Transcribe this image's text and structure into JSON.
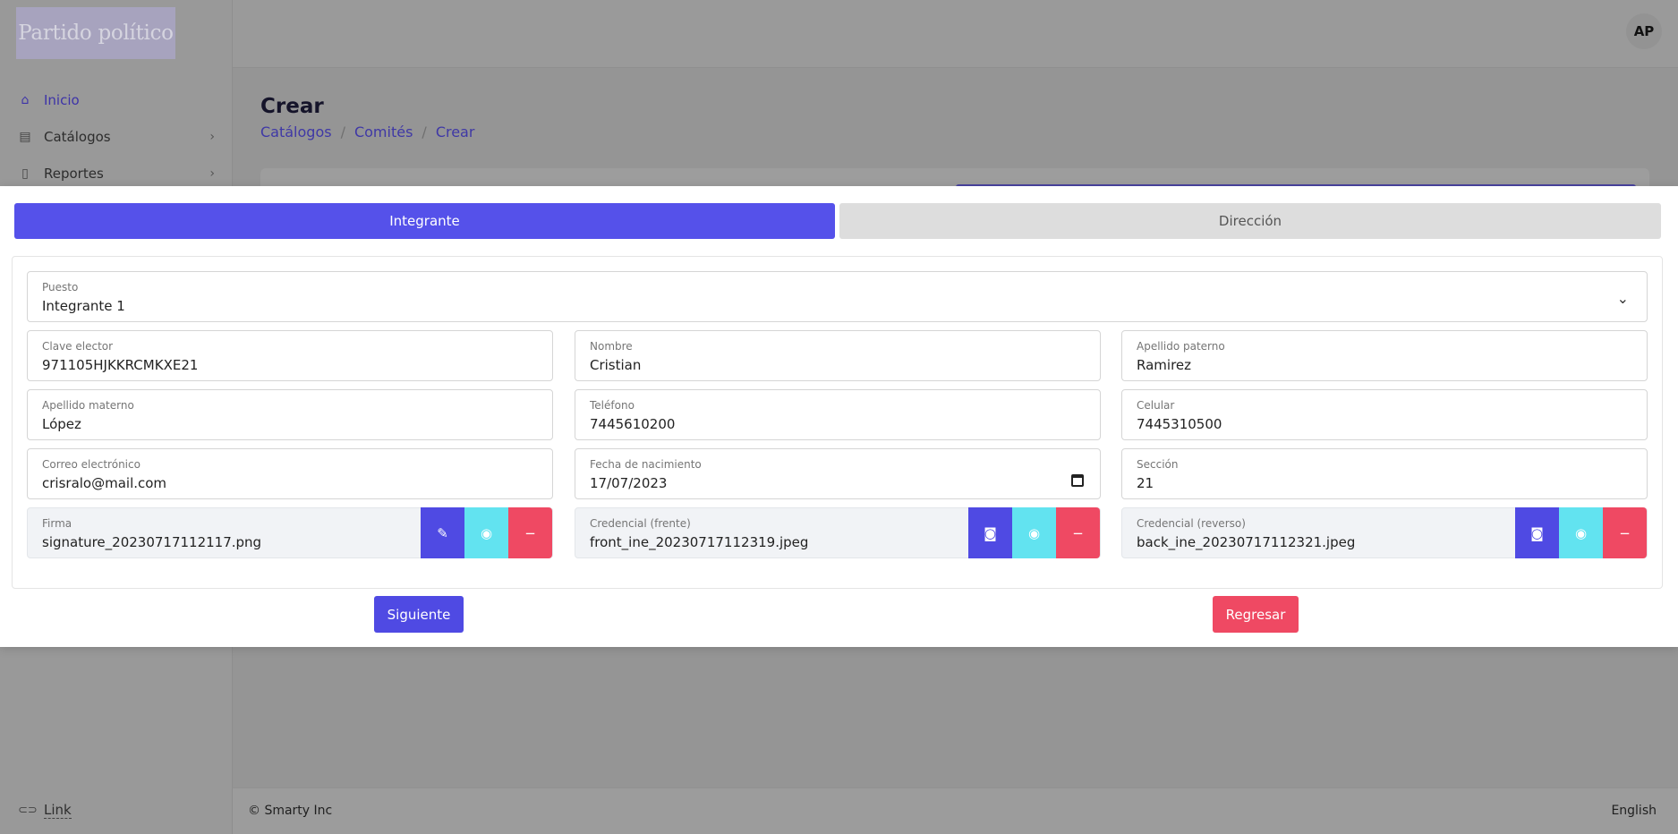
{
  "app": {
    "logo_text": "Partido político",
    "avatar_initials": "AP"
  },
  "sidebar": {
    "items": [
      {
        "label": "Inicio"
      },
      {
        "label": "Catálogos"
      },
      {
        "label": "Reportes"
      }
    ],
    "link_label": "Link"
  },
  "page": {
    "title": "Crear",
    "breadcrumb": [
      "Catálogos",
      "Comités",
      "Crear"
    ]
  },
  "footer": {
    "copyright": "© Smarty Inc",
    "language": "English"
  },
  "modal": {
    "tabs": [
      "Integrante",
      "Dirección"
    ],
    "fields": {
      "puesto": {
        "label": "Puesto",
        "value": "Integrante 1"
      },
      "clave_elector": {
        "label": "Clave elector",
        "value": "971105HJKKRCMKXE21"
      },
      "nombre": {
        "label": "Nombre",
        "value": "Cristian"
      },
      "apellido_paterno": {
        "label": "Apellido paterno",
        "value": "Ramirez"
      },
      "apellido_materno": {
        "label": "Apellido materno",
        "value": "López"
      },
      "telefono": {
        "label": "Teléfono",
        "value": "7445610200"
      },
      "celular": {
        "label": "Celular",
        "value": "7445310500"
      },
      "correo": {
        "label": "Correo electrónico",
        "value": "crisralo@mail.com"
      },
      "fecha_nacimiento": {
        "label": "Fecha de nacimiento",
        "value": "17/07/2023"
      },
      "seccion": {
        "label": "Sección",
        "value": "21"
      },
      "firma": {
        "label": "Firma",
        "value": "signature_20230717112117.png"
      },
      "credencial_frente": {
        "label": "Credencial (frente)",
        "value": "front_ine_20230717112319.jpeg"
      },
      "credencial_reverso": {
        "label": "Credencial (reverso)",
        "value": "back_ine_20230717112321.jpeg"
      }
    },
    "buttons": {
      "next": "Siguiente",
      "back": "Regresar"
    }
  },
  "colors": {
    "primary": "#5551ea",
    "info": "#62e3f0",
    "danger": "#ef4963",
    "tab_inactive": "#dddddd"
  }
}
